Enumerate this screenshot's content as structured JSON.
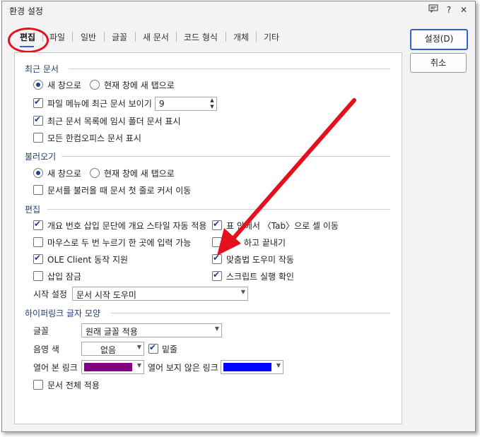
{
  "window": {
    "title": "환경 설정",
    "help_icon": "?",
    "close_icon": "✕",
    "feedback_icon": "comment-icon"
  },
  "tabs": [
    {
      "label": "편집",
      "active": true
    },
    {
      "label": "파일"
    },
    {
      "label": "일반"
    },
    {
      "label": "글꼴"
    },
    {
      "label": "새 문서"
    },
    {
      "label": "코드 형식"
    },
    {
      "label": "개체"
    },
    {
      "label": "기타"
    }
  ],
  "buttons": {
    "ok": "설정(D)",
    "cancel": "취소"
  },
  "recent": {
    "title": "최근 문서",
    "radio_new_window": "새 창으로",
    "radio_new_tab": "현재 창에 새 탭으로",
    "show_in_file_menu": "파일 메뉴에 최근 문서 보이기",
    "count": "9",
    "show_temp_folder": "최근 문서 목록에 임시 폴더 문서 표시",
    "show_all_hancom": "모든 한컴오피스 문서 표시"
  },
  "open": {
    "title": "불러오기",
    "radio_new_window": "새 창으로",
    "radio_new_tab": "현재 창에 새 탭으로",
    "cursor_first_line": "문서를 불러올 때 문서 첫 줄로 커서 이동"
  },
  "edit": {
    "title": "편집",
    "outline_style": "개요 번호 삽입 문단에 개요 스타일 자동 적용",
    "tab_cell_move": "표 안에서 〈Tab〉으로 셀 이동",
    "double_click_input": "마우스로 두 번 누르기 한 곳에 입력 가능",
    "word_wrap_end": "낱말 잘라서 끝내기",
    "word_wrap_end_visible": "하고 끝내기",
    "ole_client": "OLE Client 동작 지원",
    "spell_helper": "맞춤법 도우미 작동",
    "insert_lock": "삽입 잠금",
    "script_confirm": "스크립트 실행 확인",
    "start_setting_label": "시작 설정",
    "start_setting_value": "문서 시작 도우미"
  },
  "hyperlink": {
    "title": "하이퍼링크 글자 모양",
    "font_label": "글꼴",
    "font_value": "원래 글꼴 적용",
    "shade_label": "음영 색",
    "shade_value": "없음",
    "underline": "밑줄",
    "visited_label": "열어 본 링크",
    "visited_color": "#800080",
    "unvisited_label": "열어 보지 않은 링크",
    "unvisited_color": "#0000ff",
    "apply_all": "문서 전체 적용"
  },
  "colors": {
    "accent": "#1e3f8f",
    "annotation": "#e5101e",
    "section_title": "#1f3d79"
  }
}
